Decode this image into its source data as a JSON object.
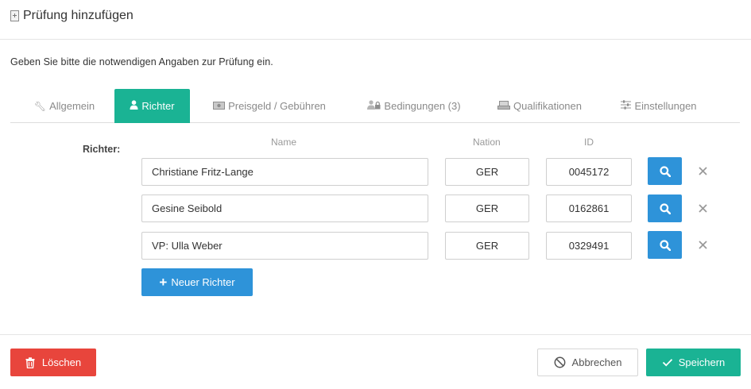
{
  "dialog": {
    "title": "Prüfung hinzufügen",
    "title_icon": "document-add-icon",
    "intro": "Geben Sie bitte die notwendigen Angaben zur Prüfung ein."
  },
  "tabs": [
    {
      "label": "Allgemein",
      "icon": "wrench-icon",
      "active": false
    },
    {
      "label": "Richter",
      "icon": "user-icon",
      "active": true
    },
    {
      "label": "Preisgeld / Gebühren",
      "icon": "money-icon",
      "active": false
    },
    {
      "label": "Bedingungen (3)",
      "icon": "user-lock-icon",
      "active": false
    },
    {
      "label": "Qualifikationen",
      "icon": "certificate-icon",
      "active": false
    },
    {
      "label": "Einstellungen",
      "icon": "sliders-icon",
      "active": false
    }
  ],
  "judges": {
    "label": "Richter:",
    "columns": {
      "name": "Name",
      "nation": "Nation",
      "id": "ID"
    },
    "rows": [
      {
        "name": "Christiane Fritz-Lange",
        "nation": "GER",
        "id": "0045172"
      },
      {
        "name": "Gesine Seibold",
        "nation": "GER",
        "id": "0162861"
      },
      {
        "name": "VP: Ulla Weber",
        "nation": "GER",
        "id": "0329491"
      }
    ],
    "add_label": "Neuer Richter"
  },
  "footer": {
    "delete_label": "Löschen",
    "cancel_label": "Abbrechen",
    "save_label": "Speichern"
  },
  "colors": {
    "accent_green": "#1ab394",
    "primary_blue": "#2e93d9",
    "danger_red": "#e8453c"
  }
}
